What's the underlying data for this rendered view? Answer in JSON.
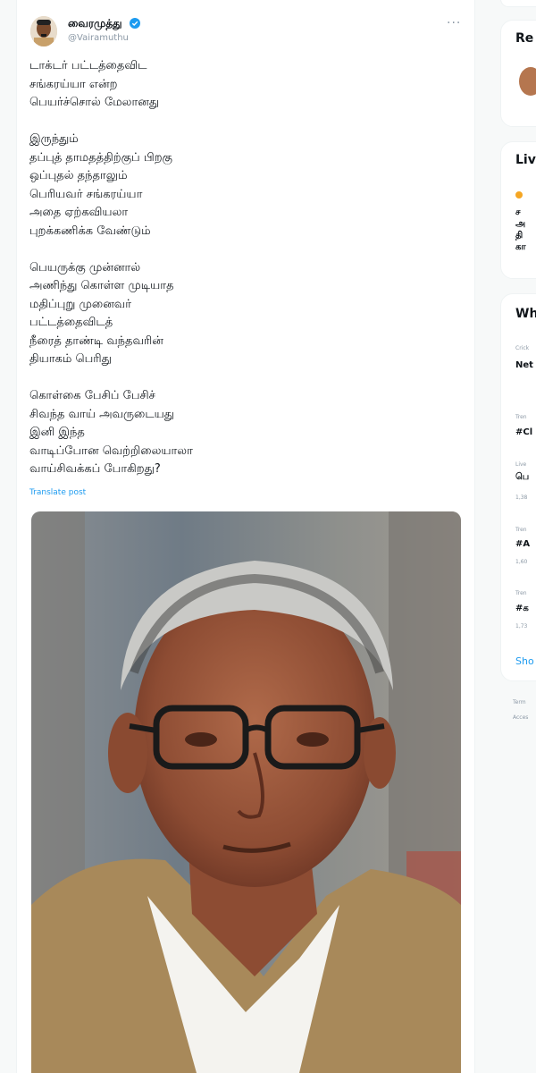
{
  "tweet": {
    "author_name": "வைரமுத்து",
    "handle": "@Vairamuthu",
    "more_icon": "more-icon",
    "text_lines": [
      "டாக்டர் பட்டத்தைவிட",
      "சங்கரய்யா என்ற",
      "பெயர்ச்சொல் மேலானது",
      "",
      "இருந்தும்",
      "தப்புத் தாமதத்திற்குப் பிறகு",
      "ஒப்புதல் தந்தாலும்",
      "பெரியவர் சங்கரய்யா",
      "அதை ஏற்கவியலா",
      "புறக்கணிக்க வேண்டும்",
      "",
      "பெயருக்கு முன்னால்",
      "அணிந்து கொள்ள முடியாத",
      "மதிப்புறு முனைவர்",
      "பட்டத்தைவிடத்",
      "நீரைத் தாண்டி வந்தவரின்",
      "தியாகம் பெரிது",
      "",
      "கொள்கை பேசிப் பேசிச்",
      "சிவந்த வாய் அவருடையது",
      "இனி இந்த",
      "வாடிப்போன வெற்றிலையாலா",
      "வாய்சிவக்கப் போகிறது?"
    ],
    "translate_label": "Translate post"
  },
  "sidebar": {
    "relevant_title": "Re",
    "live_title": "Liv",
    "live_lines": [
      "ச",
      "அ",
      "தி",
      "கா"
    ],
    "whats_happening_title": "Wh",
    "trends": [
      {
        "category": "Crick",
        "name": "Net",
        "count": ""
      },
      {
        "category": "Tren",
        "name": "#Cl",
        "count": ""
      },
      {
        "category": "Live",
        "name": "பெ",
        "count": "1,38"
      },
      {
        "category": "Tren",
        "name": "#A",
        "count": "1,60"
      },
      {
        "category": "Tren",
        "name": "#க",
        "count": "1,73"
      }
    ],
    "show_more": "Sho",
    "footer_lines": [
      "Term",
      "Acces"
    ]
  },
  "colors": {
    "accent": "#1d9bf0",
    "text": "#0f1419",
    "muted": "#8b98a5",
    "background": "#f7f9f9"
  }
}
